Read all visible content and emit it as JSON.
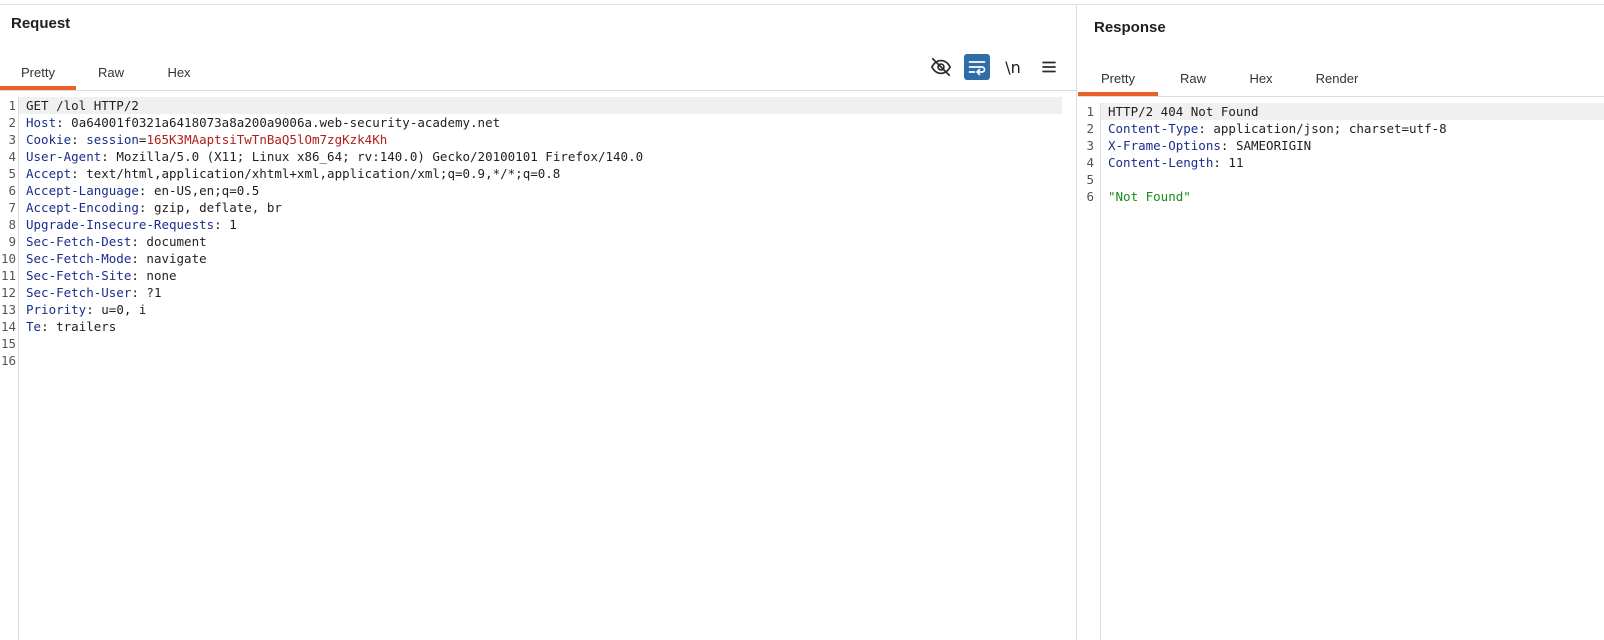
{
  "request": {
    "title": "Request",
    "tabs": [
      "Pretty",
      "Raw",
      "Hex"
    ],
    "active_tab": "Pretty",
    "toolbar": {
      "hide_icon": "eye-slash-icon",
      "wrap_icon": "word-wrap-icon",
      "newline_label": "\\n",
      "menu_icon": "hamburger-menu-icon"
    },
    "lines": [
      {
        "n": "1",
        "key": "",
        "sep": "",
        "value": "GET /lol HTTP/2"
      },
      {
        "n": "2",
        "key": "Host",
        "sep": ": ",
        "value": "0a64001f0321a6418073a8a200a9006a.web-security-academy.net"
      },
      {
        "n": "3",
        "key": "Cookie",
        "sep": ": ",
        "cookie_name": "session",
        "cookie_eq": "=",
        "cookie_value": "165K3MAaptsiTwTnBaQ5lOm7zgKzk4Kh"
      },
      {
        "n": "4",
        "key": "User-Agent",
        "sep": ": ",
        "value": "Mozilla/5.0 (X11; Linux x86_64; rv:140.0) Gecko/20100101 Firefox/140.0"
      },
      {
        "n": "5",
        "key": "Accept",
        "sep": ": ",
        "value": "text/html,application/xhtml+xml,application/xml;q=0.9,*/*;q=0.8"
      },
      {
        "n": "6",
        "key": "Accept-Language",
        "sep": ": ",
        "value": "en-US,en;q=0.5"
      },
      {
        "n": "7",
        "key": "Accept-Encoding",
        "sep": ": ",
        "value": "gzip, deflate, br"
      },
      {
        "n": "8",
        "key": "Upgrade-Insecure-Requests",
        "sep": ": ",
        "value": "1"
      },
      {
        "n": "9",
        "key": "Sec-Fetch-Dest",
        "sep": ": ",
        "value": "document"
      },
      {
        "n": "10",
        "key": "Sec-Fetch-Mode",
        "sep": ": ",
        "value": "navigate"
      },
      {
        "n": "11",
        "key": "Sec-Fetch-Site",
        "sep": ": ",
        "value": "none"
      },
      {
        "n": "12",
        "key": "Sec-Fetch-User",
        "sep": ": ",
        "value": "?1"
      },
      {
        "n": "13",
        "key": "Priority",
        "sep": ": ",
        "value": "u=0, i"
      },
      {
        "n": "14",
        "key": "Te",
        "sep": ": ",
        "value": "trailers"
      },
      {
        "n": "15",
        "key": "",
        "sep": "",
        "value": ""
      },
      {
        "n": "16",
        "key": "",
        "sep": "",
        "value": ""
      }
    ]
  },
  "response": {
    "title": "Response",
    "tabs": [
      "Pretty",
      "Raw",
      "Hex",
      "Render"
    ],
    "active_tab": "Pretty",
    "lines": [
      {
        "n": "1",
        "key": "",
        "sep": "",
        "value": "HTTP/2 404 Not Found"
      },
      {
        "n": "2",
        "key": "Content-Type",
        "sep": ": ",
        "value": "application/json; charset=utf-8"
      },
      {
        "n": "3",
        "key": "X-Frame-Options",
        "sep": ": ",
        "value": "SAMEORIGIN"
      },
      {
        "n": "4",
        "key": "Content-Length",
        "sep": ": ",
        "value": "11"
      },
      {
        "n": "5",
        "key": "",
        "sep": "",
        "value": ""
      },
      {
        "n": "6",
        "key": "",
        "sep": "",
        "string": "\"Not Found\""
      }
    ]
  },
  "colors": {
    "accent": "#e8602c",
    "header_key": "#1a2e8c",
    "cookie_value": "#b0201a",
    "json_string": "#1a8a1a",
    "toggle_on": "#2e6da8"
  }
}
